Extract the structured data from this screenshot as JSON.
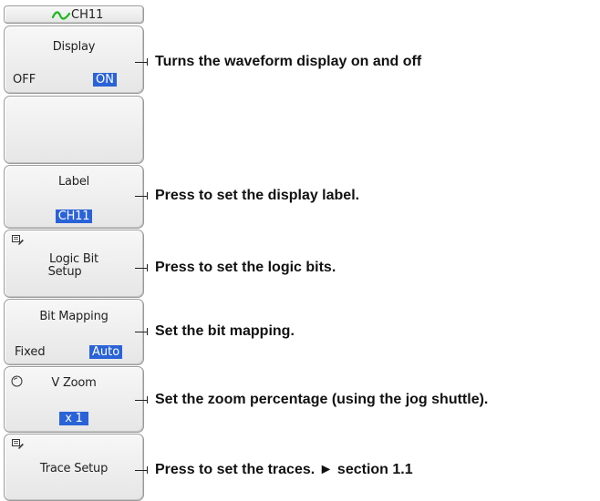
{
  "header": {
    "channel": "CH11",
    "wave_icon_color": "#19b819"
  },
  "menu": {
    "display": {
      "title": "Display",
      "options": [
        "OFF",
        "ON"
      ],
      "selected": "ON"
    },
    "label": {
      "title": "Label",
      "value": "CH11"
    },
    "logic_bit": {
      "line1": "Logic Bit",
      "line2": "Setup",
      "icon": "edit-icon"
    },
    "bit_mapping": {
      "title": "Bit Mapping",
      "options": [
        "Fixed",
        "Auto"
      ],
      "selected": "Auto"
    },
    "v_zoom": {
      "title": "V Zoom",
      "value": "x 1",
      "icon": "jog-knob-icon"
    },
    "trace": {
      "title": "Trace Setup",
      "icon": "edit-icon"
    }
  },
  "callouts": {
    "display": "Turns the waveform display on and off",
    "label": "Press to set the display label.",
    "logic_bit": "Press to set the logic bits.",
    "bit_mapping": "Set the bit mapping.",
    "v_zoom": "Set the zoom percentage (using the jog shuttle).",
    "trace": "Press to set the traces. ► section 1.1"
  },
  "colors": {
    "highlight": "#2a62d8",
    "panel_border": "#9a9a9a"
  }
}
